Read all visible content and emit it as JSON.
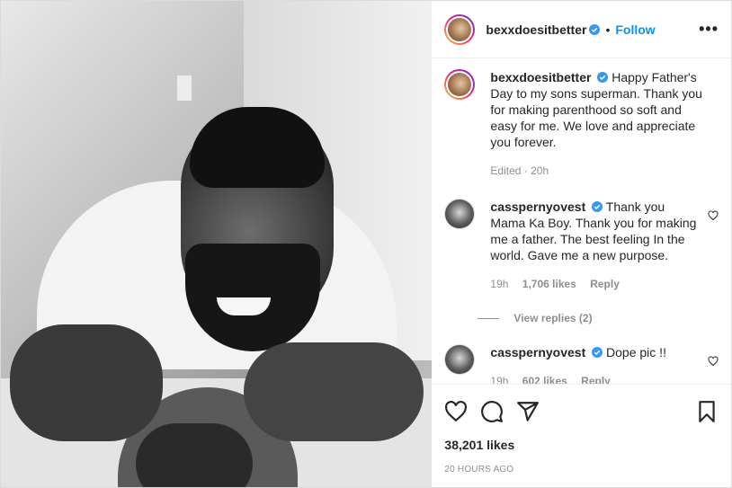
{
  "header": {
    "username": "bexxdoesitbetter",
    "separator": "•",
    "follow_label": "Follow",
    "more_label": "•••"
  },
  "caption": {
    "username": "bexxdoesitbetter",
    "text": "Happy Father's Day to my sons superman. Thank you for making parenthood so soft and easy for me. We love and appreciate you forever.",
    "meta": "Edited · 20h"
  },
  "comments": [
    {
      "username": "casspernyovest",
      "text": "Thank you Mama Ka Boy. Thank you for making me a father. The best feeling In the world. Gave me a new purpose.",
      "time": "19h",
      "likes": "1,706 likes",
      "reply_label": "Reply",
      "view_replies": "View replies (2)"
    },
    {
      "username": "casspernyovest",
      "text": "Dope pic !!",
      "time": "19h",
      "likes": "602 likes",
      "reply_label": "Reply"
    }
  ],
  "likes_count": "38,201 likes",
  "timestamp": "20 HOURS AGO",
  "icons": [
    "heart-icon",
    "comment-icon",
    "share-icon",
    "bookmark-icon",
    "verified-icon"
  ],
  "colors": {
    "accent": "#0095f6",
    "muted": "#8e8e8e",
    "text": "#262626"
  }
}
